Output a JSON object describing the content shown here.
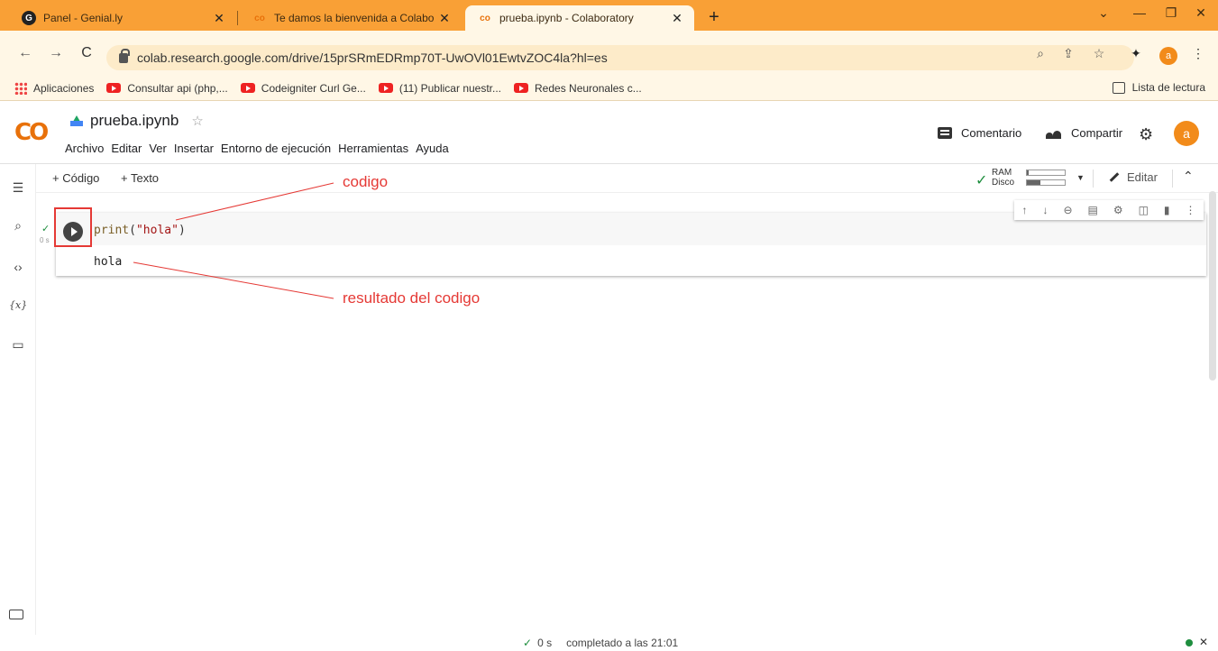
{
  "browser": {
    "tabs": [
      {
        "title": "Panel - Genial.ly",
        "icon": "genially-icon",
        "active": false
      },
      {
        "title": "Te damos la bienvenida a Colabo",
        "icon": "colab-icon",
        "active": false
      },
      {
        "title": "prueba.ipynb - Colaboratory",
        "icon": "colab-icon",
        "active": true
      }
    ],
    "new_tab": "+",
    "url": "colab.research.google.com/drive/15prSRmEDRmp70T-UwOVl01EwtvZOC4la?hl=es",
    "profile_initial": "a",
    "bookmarks": [
      "Aplicaciones",
      "Consultar api (php,...",
      "Codeigniter Curl Ge...",
      "(11) Publicar nuestr...",
      "Redes Neuronales c..."
    ],
    "reading_list": "Lista de lectura"
  },
  "colab": {
    "logo": "CO",
    "notebook_title": "prueba.ipynb",
    "menu": [
      "Archivo",
      "Editar",
      "Ver",
      "Insertar",
      "Entorno de ejecución",
      "Herramientas",
      "Ayuda"
    ],
    "comment": "Comentario",
    "share": "Compartir",
    "avatar_initial": "a",
    "toolbar": {
      "add_code": "+ Código",
      "add_text": "+ Texto",
      "ram_label": "RAM",
      "disk_label": "Disco",
      "ram_usage": 0.05,
      "disk_usage": 0.35,
      "edit": "Editar"
    },
    "cell": {
      "exec_time": "0 s",
      "code_fn": "print",
      "code_paren_open": "(",
      "code_string": "\"hola\"",
      "code_paren_close": ")",
      "output": "hola"
    }
  },
  "annotations": {
    "code": "codigo",
    "result": "resultado del codigo"
  },
  "status": {
    "time": "0 s",
    "message": "completado a las 21:01"
  },
  "colors": {
    "tabstrip": "#f9a036",
    "annotation": "#e53935",
    "success": "#1e8e3e",
    "avatar": "#f28b1a"
  }
}
